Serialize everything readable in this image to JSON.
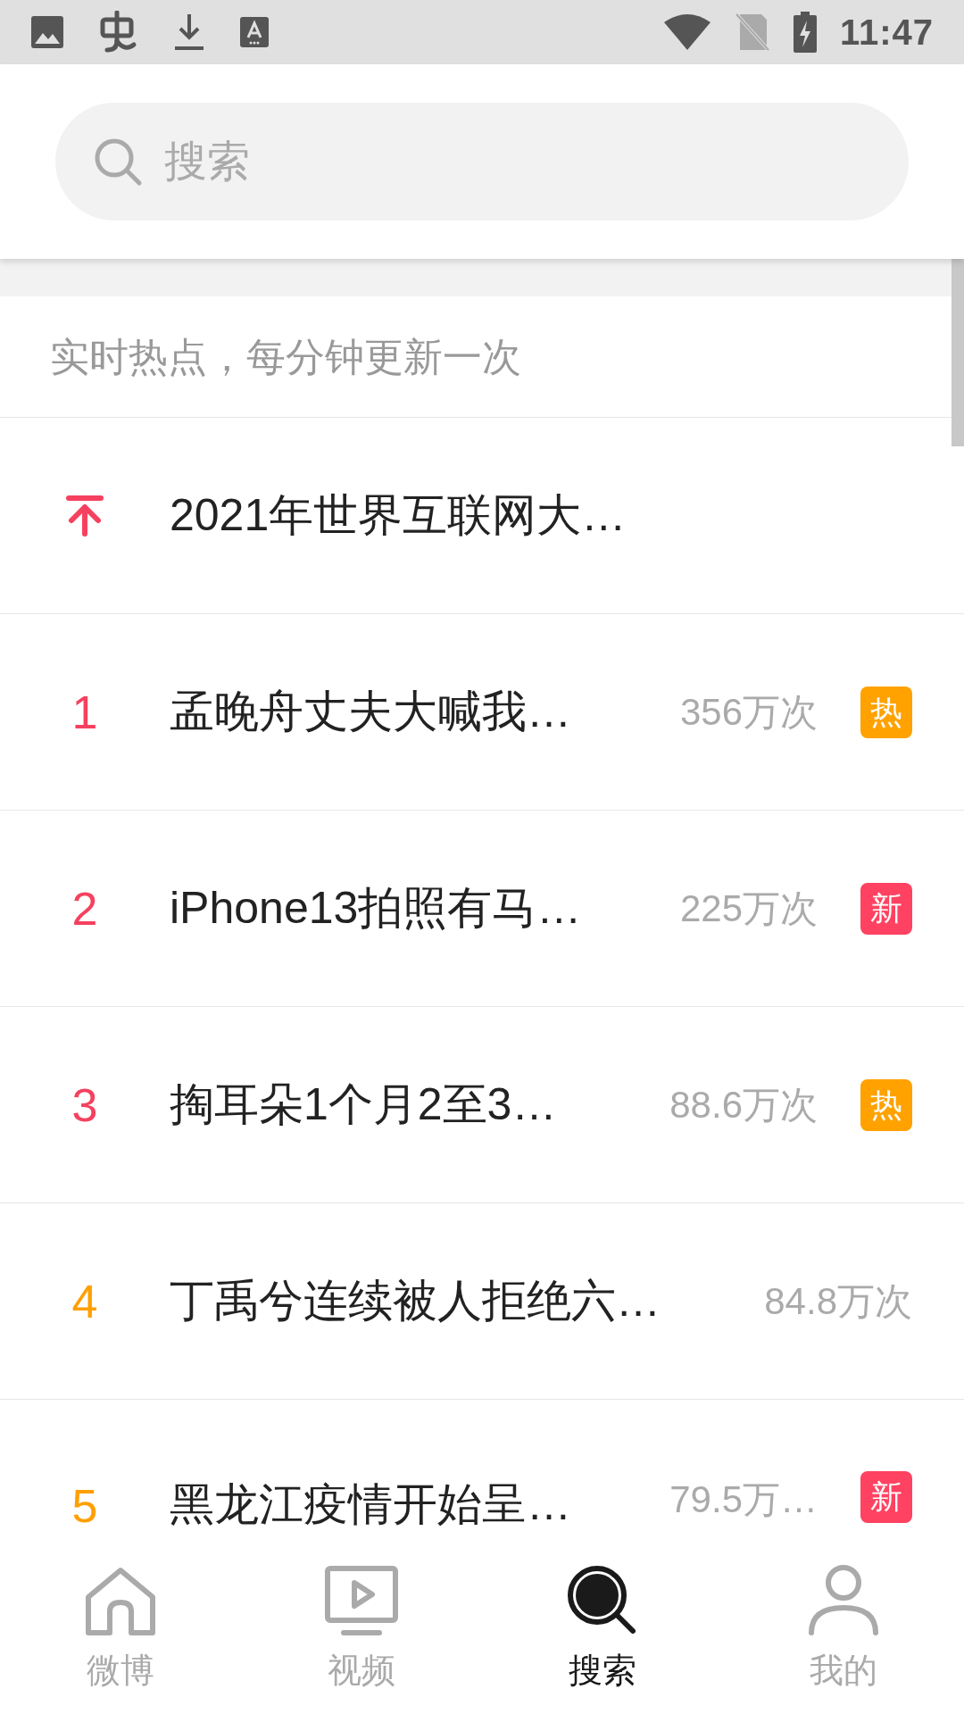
{
  "status_bar": {
    "time": "11:47"
  },
  "search": {
    "placeholder": "搜索"
  },
  "hot_list": {
    "caption": "实时热点，每分钟更新一次",
    "rows": [
      {
        "kind": "pinned",
        "color": "#f5415f",
        "title": "2021年世界互联网大…"
      },
      {
        "kind": "ranked",
        "rank": "1",
        "color": "#f5415f",
        "title": "孟晚舟丈夫大喊我…",
        "count": "356万次",
        "badge": {
          "text": "热",
          "color": "#ffa200"
        }
      },
      {
        "kind": "ranked",
        "rank": "2",
        "color": "#f5415f",
        "title": "iPhone13拍照有马…",
        "count": "225万次",
        "badge": {
          "text": "新",
          "color": "#ff4261"
        }
      },
      {
        "kind": "ranked",
        "rank": "3",
        "color": "#f5415f",
        "title": "掏耳朵1个月2至3…",
        "count": "88.6万次",
        "badge": {
          "text": "热",
          "color": "#ffa200"
        }
      },
      {
        "kind": "ranked",
        "rank": "4",
        "color": "#ff9f00",
        "title": "丁禹兮连续被人拒绝六…",
        "count": "84.8万次"
      },
      {
        "kind": "ranked",
        "rank": "5",
        "color": "#ff9f00",
        "title": "黑龙江疫情开始呈…",
        "count": "79.5万…",
        "badge": {
          "text": "新",
          "color": "#ff4261"
        }
      }
    ]
  },
  "bottom_nav": [
    {
      "kind": "home",
      "label": "微博",
      "selected": false
    },
    {
      "kind": "video",
      "label": "视频",
      "selected": false
    },
    {
      "kind": "search",
      "label": "搜索",
      "selected": true
    },
    {
      "kind": "profile",
      "label": "我的",
      "selected": false
    }
  ]
}
